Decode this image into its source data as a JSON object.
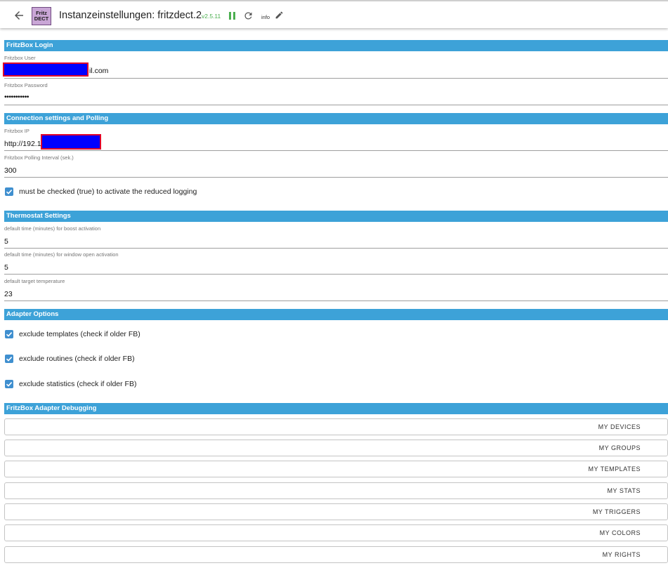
{
  "header": {
    "logo_line1": "Fritz",
    "logo_line2": "DECT",
    "title": "Instanzeinstellungen: fritzdect.2",
    "version": "v2.5.11",
    "info_label": "info",
    "colors": {
      "version": "#4caf50",
      "pause": "#4caf50"
    }
  },
  "sections": {
    "login": "FritzBox Login",
    "connection": "Connection settings and Polling",
    "thermostat": "Thermostat Settings",
    "adapter": "Adapter Options",
    "debug": "FritzBox Adapter Debugging"
  },
  "fields": {
    "user": {
      "label": "Fritzbox User",
      "value": "il.com"
    },
    "password": {
      "label": "Fritzbox Password",
      "value": "•••••••••••"
    },
    "ip": {
      "label": "Fritzbox IP",
      "value": "http://192.1"
    },
    "polling": {
      "label": "Fritzbox Polling Interval (sek.)",
      "value": "300"
    },
    "boost": {
      "label": "default time (minutes) for boost activation",
      "value": "5"
    },
    "window": {
      "label": "default time (minutes) for window open activation",
      "value": "5"
    },
    "target": {
      "label": "default target temperature",
      "value": "23"
    }
  },
  "checks": {
    "reduced_logging": {
      "label": "must be checked (true) to activate the reduced logging",
      "checked": true
    },
    "exclude_templates": {
      "label": "exclude templates (check if older FB)",
      "checked": true
    },
    "exclude_routines": {
      "label": "exclude routines (check if older FB)",
      "checked": true
    },
    "exclude_statistics": {
      "label": "exclude statistics (check if older FB)",
      "checked": true
    }
  },
  "debug_buttons": [
    "MY DEVICES",
    "MY GROUPS",
    "MY TEMPLATES",
    "MY STATS",
    "MY TRIGGERS",
    "MY COLORS",
    "MY RIGHTS"
  ],
  "theme": {
    "section_header": "#3da2d8",
    "checkbox": "#3f8fcf",
    "redaction": "#0000ff",
    "redaction_border": "#e0002a"
  }
}
